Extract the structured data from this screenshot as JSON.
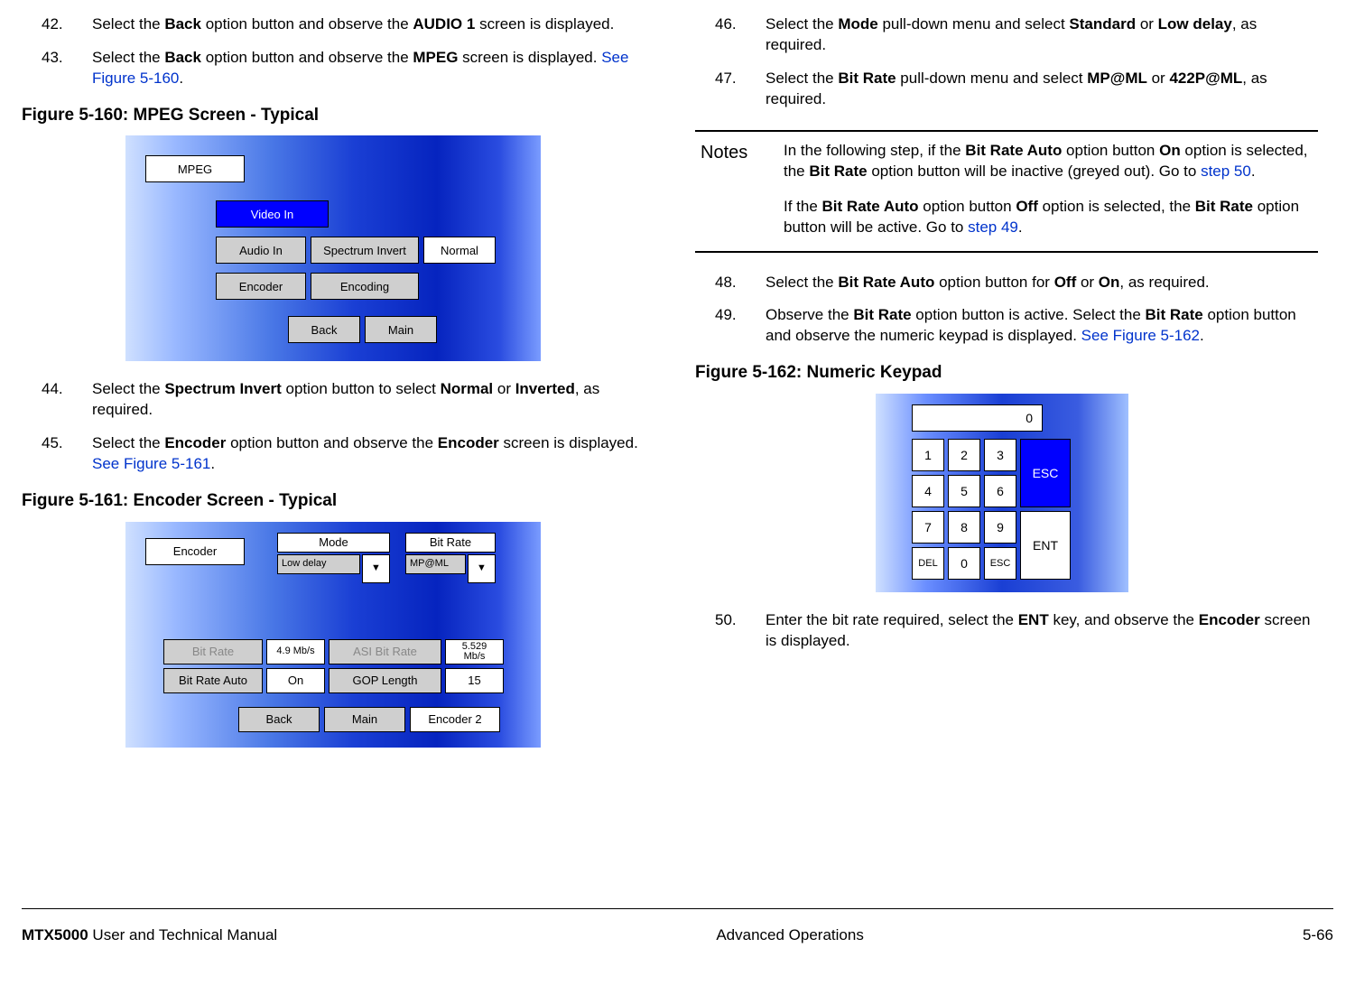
{
  "left": {
    "steps_a": [
      {
        "num": "42.",
        "pre": "Select the ",
        "b1": "Back",
        "mid": " option button and observe the ",
        "b2": "AUDIO 1",
        "post": " screen is displayed."
      },
      {
        "num": "43.",
        "pre": "Select the ",
        "b1": "Back",
        "mid": " option button and observe the ",
        "b2": "MPEG",
        "post": " screen is displayed.  ",
        "link": "See Figure 5-160",
        "tail": "."
      }
    ],
    "fig160_caption": "Figure 5-160:   MPEG Screen - Typical",
    "fig160": {
      "mpeg": "MPEG",
      "video_in": "Video In",
      "audio_in": "Audio In",
      "spectrum_invert": "Spectrum Invert",
      "normal": "Normal",
      "encoder": "Encoder",
      "encoding": "Encoding",
      "back": "Back",
      "main": "Main"
    },
    "steps_b": [
      {
        "num": "44.",
        "pre": "Select the ",
        "b1": "Spectrum Invert",
        "mid": " option button to select ",
        "b2": "Normal",
        "mid2": " or ",
        "b3": "Inverted",
        "post": ", as required."
      },
      {
        "num": "45.",
        "pre": "Select the ",
        "b1": "Encoder",
        "mid": " option button and observe the ",
        "b2": "Encoder",
        "post": " screen is displayed.  ",
        "link": "See Figure 5-161",
        "tail": "."
      }
    ],
    "fig161_caption": "Figure 5-161:   Encoder Screen - Typical",
    "fig161": {
      "encoder": "Encoder",
      "mode": "Mode",
      "bit_rate_label": "Bit Rate",
      "low_delay": "Low delay",
      "mpml": "MP@ML",
      "tri": "▼",
      "bit_rate_btn": "Bit Rate",
      "v49": "4.9 Mb/s",
      "asi": "ASI Bit Rate",
      "v5529a": "5.529",
      "v5529b": "Mb/s",
      "bit_rate_auto": "Bit Rate Auto",
      "on": "On",
      "gop": "GOP Length",
      "fifteen": "15",
      "back": "Back",
      "main": "Main",
      "encoder2": "Encoder 2"
    }
  },
  "right": {
    "steps_a": [
      {
        "num": "46.",
        "pre": "Select the ",
        "b1": "Mode",
        "mid": " pull-down menu and select ",
        "b2": "Standard",
        "mid2": " or ",
        "b3": "Low delay",
        "post": ", as required."
      },
      {
        "num": "47.",
        "pre": "Select the ",
        "b1": "Bit Rate",
        "mid": " pull-down menu and select ",
        "b2": "MP@ML",
        "mid2": " or ",
        "b3": "422P@ML",
        "post": ", as required."
      }
    ],
    "notes_label": "Notes",
    "notes_p1_a": "In the following step, if the ",
    "notes_p1_b1": "Bit Rate Auto",
    "notes_p1_b": " option button ",
    "notes_p1_b2": "On",
    "notes_p1_c": " option is selected, the ",
    "notes_p1_b3": "Bit Rate",
    "notes_p1_d": " option button will be inactive (greyed out).  Go to ",
    "notes_p1_link": "step 50",
    "notes_p1_e": ".",
    "notes_p2_a": "If the ",
    "notes_p2_b1": "Bit Rate Auto",
    "notes_p2_b": " option button ",
    "notes_p2_b2": "Off",
    "notes_p2_c": " option is selected, the ",
    "notes_p2_b3": "Bit Rate",
    "notes_p2_d": " option button will be active.  Go to ",
    "notes_p2_link": "step 49",
    "notes_p2_e": ".",
    "steps_b": [
      {
        "num": "48.",
        "pre": "Select the ",
        "b1": "Bit Rate Auto",
        "mid": " option button for ",
        "b2": "Off",
        "mid2": " or ",
        "b3": "On",
        "post": ", as required."
      },
      {
        "num": "49.",
        "pre": "Observe the ",
        "b1": "Bit Rate",
        "mid": " option button is active.  Select the ",
        "b2": "Bit Rate",
        "post2": " option button and observe the numeric keypad is displayed.  ",
        "link": "See Figure 5-162",
        "tail": "."
      }
    ],
    "fig162_caption": "Figure 5-162:   Numeric Keypad",
    "keypad": {
      "display": "0",
      "k1": "1",
      "k2": "2",
      "k3": "3",
      "k4": "4",
      "k5": "5",
      "k6": "6",
      "k7": "7",
      "k8": "8",
      "k9": "9",
      "del": "DEL",
      "k0": "0",
      "esc_small": "ESC",
      "esc": "ESC",
      "ent": "ENT"
    },
    "steps_c": [
      {
        "num": "50.",
        "pre": "Enter the bit rate required, select the ",
        "b1": "ENT",
        "mid": " key, and observe the ",
        "b2": "Encoder",
        "post": " screen is displayed."
      }
    ]
  },
  "footer": {
    "left_a": "MTX5000",
    "left_b": " User and Technical Manual ",
    "center": "Advanced Operations",
    "right": "5-66"
  }
}
